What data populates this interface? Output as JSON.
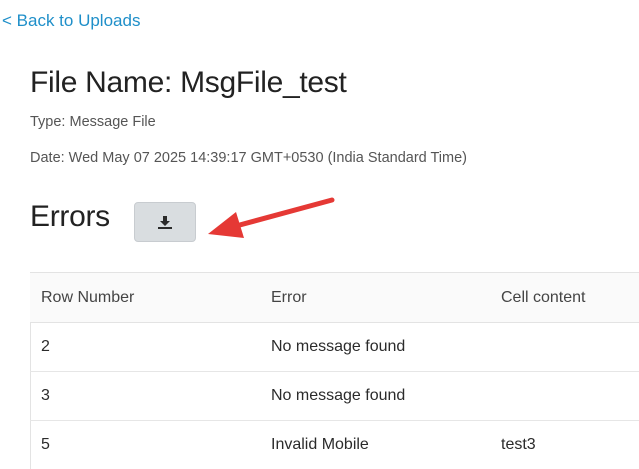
{
  "nav": {
    "back_label": "< Back to Uploads"
  },
  "file": {
    "title": "File Name: MsgFile_test",
    "type": "Type: Message File",
    "date": "Date: Wed May 07 2025 14:39:17 GMT+0530 (India Standard Time)"
  },
  "errors": {
    "heading": "Errors",
    "download_icon": "download-icon",
    "columns": [
      "Row Number",
      "Error",
      "Cell content"
    ],
    "rows": [
      {
        "row": "2",
        "error": "No message found",
        "cell": ""
      },
      {
        "row": "3",
        "error": "No message found",
        "cell": ""
      },
      {
        "row": "5",
        "error": "Invalid Mobile",
        "cell": "test3"
      }
    ]
  },
  "colors": {
    "link": "#1f8fc9",
    "button_bg": "#d9dde0",
    "annotation_arrow": "#e53935"
  }
}
